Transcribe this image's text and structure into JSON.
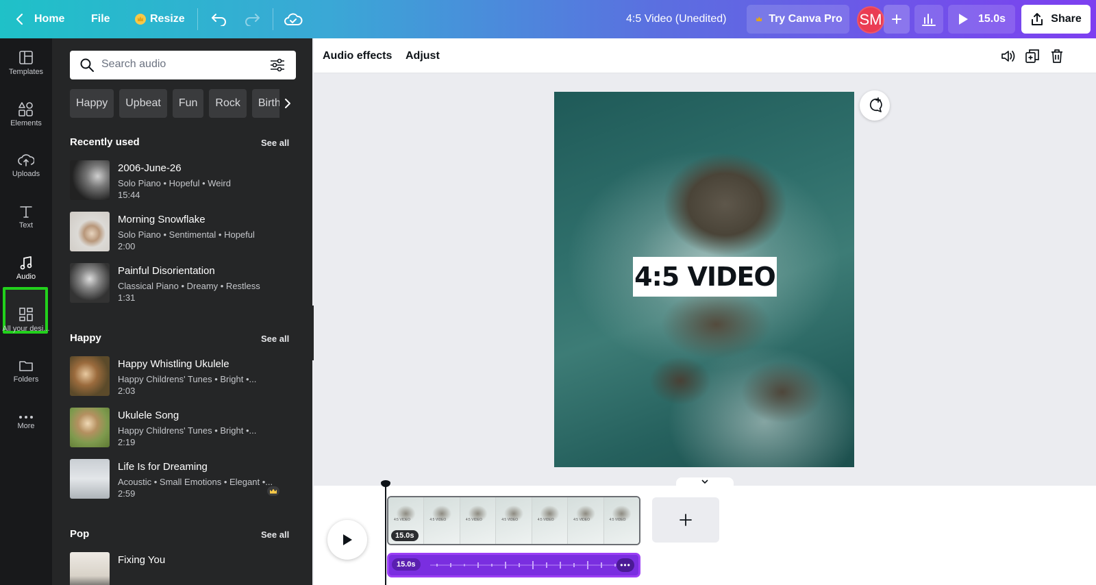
{
  "topbar": {
    "home": "Home",
    "file": "File",
    "resize": "Resize",
    "doc_title": "4:5 Video (Unedited)",
    "try_pro": "Try Canva Pro",
    "avatar_initials": "SM",
    "duration": "15.0s",
    "share": "Share"
  },
  "rail": {
    "templates": "Templates",
    "elements": "Elements",
    "uploads": "Uploads",
    "text": "Text",
    "audio": "Audio",
    "all_designs": "All your desi...",
    "folders": "Folders",
    "more": "More"
  },
  "panel": {
    "search_placeholder": "Search audio",
    "chips": [
      "Happy",
      "Upbeat",
      "Fun",
      "Rock",
      "Birthda"
    ],
    "see_all": "See all",
    "sections": [
      {
        "title": "Recently used",
        "tracks": [
          {
            "title": "2006-June-26",
            "meta": "Solo Piano • Hopeful • Weird",
            "duration": "15:44"
          },
          {
            "title": "Morning Snowflake",
            "meta": "Solo Piano • Sentimental • Hopeful",
            "duration": "2:00"
          },
          {
            "title": "Painful Disorientation",
            "meta": "Classical Piano • Dreamy • Restless",
            "duration": "1:31"
          }
        ]
      },
      {
        "title": "Happy",
        "tracks": [
          {
            "title": "Happy Whistling Ukulele",
            "meta": "Happy Childrens' Tunes • Bright •...",
            "duration": "2:03"
          },
          {
            "title": "Ukulele Song",
            "meta": "Happy Childrens' Tunes • Bright •...",
            "duration": "2:19"
          },
          {
            "title": "Life Is for Dreaming",
            "meta": "Acoustic • Small Emotions • Elegant •...",
            "duration": "2:59"
          }
        ]
      },
      {
        "title": "Pop",
        "tracks": [
          {
            "title": "Fixing You",
            "meta": "",
            "duration": ""
          }
        ]
      }
    ]
  },
  "context_toolbar": {
    "audio_effects": "Audio effects",
    "adjust": "Adjust"
  },
  "canvas": {
    "overlay_text": "4:5 VIDEO"
  },
  "timeline": {
    "video_clip_duration": "15.0s",
    "audio_clip_duration": "15.0s",
    "frame_label": "4:5 VIDEO",
    "frame_count": 7
  },
  "colors": {
    "highlight": "#22d11c",
    "audio_clip": "#7a2ee0",
    "avatar": "#ea3c53",
    "panel_bg": "#252627",
    "rail_bg": "#18191b"
  }
}
